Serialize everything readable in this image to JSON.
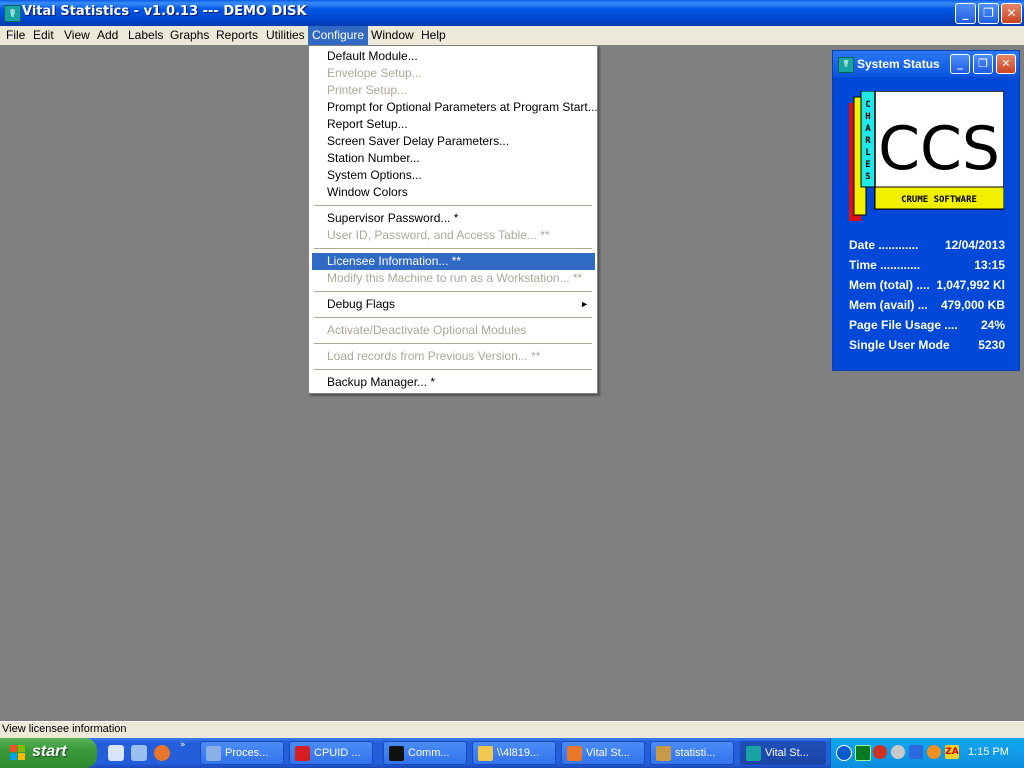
{
  "window": {
    "title": "Vital Statistics - v1.0.13 --- DEMO DISK",
    "icon": "caduceus-icon",
    "minimize": "_",
    "maximize": "❐",
    "close": "✕"
  },
  "menubar": [
    "File",
    "Edit",
    "View",
    "Add",
    "Labels",
    "Graphs",
    "Reports",
    "Utilities",
    "Configure",
    "Window",
    "Help"
  ],
  "configure_menu": {
    "items": [
      "Default Module...",
      "Envelope Setup...",
      "Printer Setup...",
      "Prompt for Optional Parameters at Program Start...",
      "Report Setup...",
      "Screen Saver Delay Parameters...",
      "Station Number...",
      "System Options...",
      "Window Colors",
      "Supervisor Password... *",
      "User ID, Password, and Access Table... **",
      "Licensee Information... **",
      "Modify this Machine to run as a Workstation... **",
      "Debug Flags",
      "Activate/Deactivate Optional Modules",
      "Load records from Previous Version... **",
      "Backup Manager... *"
    ],
    "submenu_arrow": "►"
  },
  "system_status": {
    "title": "System Status",
    "logo": {
      "vertical": "CHARLES",
      "monogram": "CCS",
      "banner": "CRUME SOFTWARE"
    },
    "rows": [
      {
        "label": "Date ............",
        "value": "12/04/2013"
      },
      {
        "label": "Time ............",
        "value": "13:15"
      },
      {
        "label": "Mem (total) ....",
        "value": "1,047,992 Kl"
      },
      {
        "label": "Mem (avail) ...",
        "value": "479,000 KB"
      },
      {
        "label": "Page File Usage ....",
        "value": "24%"
      },
      {
        "label": "Single User Mode",
        "value": "5230"
      }
    ]
  },
  "statusbar": {
    "text": "View licensee information"
  },
  "taskbar": {
    "start": "start",
    "tasks": [
      {
        "label": "Proces...",
        "icon": "process-icon",
        "color": "#8bb0e8"
      },
      {
        "label": "CPUID ...",
        "icon": "cpuid-icon",
        "color": "#d81e1e"
      },
      {
        "label": "Comm...",
        "icon": "console-icon",
        "color": "#111111"
      },
      {
        "label": "\\\\4l819...",
        "icon": "folder-icon",
        "color": "#f0c850"
      },
      {
        "label": "Vital St...",
        "icon": "firefox-icon",
        "color": "#e8772a"
      },
      {
        "label": "statisti...",
        "icon": "app-icon",
        "color": "#c89a48"
      },
      {
        "label": "Vital St...",
        "icon": "caduceus-icon",
        "color": "#1aa3a3"
      }
    ],
    "clock": "1:15 PM"
  }
}
